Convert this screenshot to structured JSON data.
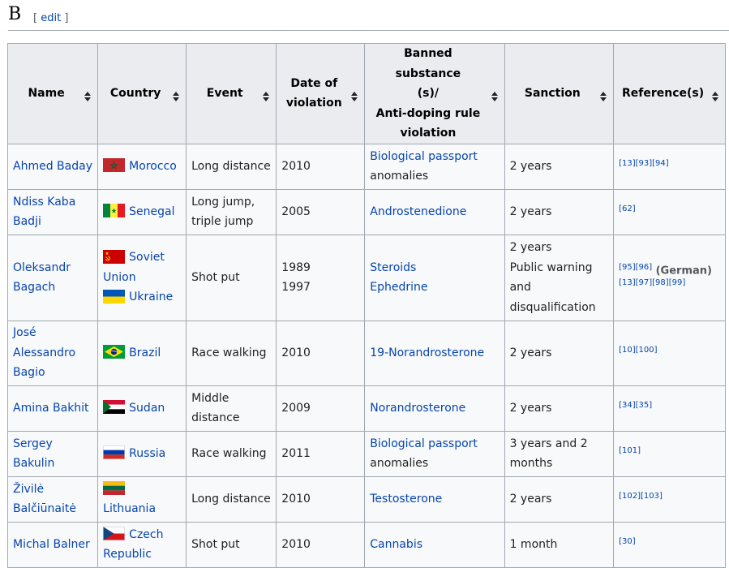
{
  "section": {
    "letter": "B",
    "edit_open": "[ ",
    "edit_label": "edit",
    "edit_close": " ]"
  },
  "table": {
    "columns": [
      {
        "l1": "Name",
        "l2": "",
        "l3": "",
        "l4": ""
      },
      {
        "l1": "Country",
        "l2": "",
        "l3": "",
        "l4": ""
      },
      {
        "l1": "Event",
        "l2": "",
        "l3": "",
        "l4": ""
      },
      {
        "l1": "Date of",
        "l2": "violation",
        "l3": "",
        "l4": ""
      },
      {
        "l1": "Banned substance",
        "l2": "(s)/",
        "l3": "Anti-doping rule",
        "l4": "violation"
      },
      {
        "l1": "Sanction",
        "l2": "",
        "l3": "",
        "l4": ""
      },
      {
        "l1": "Reference(s)",
        "l2": "",
        "l3": "",
        "l4": ""
      }
    ],
    "rows": [
      {
        "name": [
          "Ahmed Baday"
        ],
        "countries": [
          {
            "flag": "morocco-flag-icon",
            "lines": [
              "Morocco"
            ]
          }
        ],
        "event": [
          "Long distance"
        ],
        "date": [
          "2010"
        ],
        "substance": [
          {
            "text": "Biological passport",
            "link": true
          },
          {
            "text": "anomalies",
            "link": false
          }
        ],
        "sanction": [
          "2 years"
        ],
        "refs": [
          [
            "[13]",
            "[93]",
            "[94]"
          ]
        ],
        "note": ""
      },
      {
        "name": [
          "Ndiss Kaba",
          "Badji"
        ],
        "countries": [
          {
            "flag": "senegal-flag-icon",
            "lines": [
              "Senegal"
            ]
          }
        ],
        "event": [
          "Long jump,",
          "triple jump"
        ],
        "date": [
          "2005"
        ],
        "substance": [
          {
            "text": "Androstenedione",
            "link": true
          }
        ],
        "sanction": [
          "2 years"
        ],
        "refs": [
          [
            "[62]"
          ]
        ],
        "note": ""
      },
      {
        "name": [
          "Oleksandr",
          "Bagach"
        ],
        "countries": [
          {
            "flag": "soviet-union-flag-icon",
            "lines": [
              "Soviet",
              "Union"
            ]
          },
          {
            "flag": "ukraine-flag-icon",
            "lines": [
              "Ukraine"
            ]
          }
        ],
        "event": [
          "Shot put"
        ],
        "date": [
          "1989",
          "1997"
        ],
        "substance": [
          {
            "text": "Steroids",
            "link": true
          },
          {
            "text": "Ephedrine",
            "link": true
          }
        ],
        "sanction": [
          "2 years",
          "Public warning",
          "and",
          "disqualification"
        ],
        "refs": [
          [
            "[95]",
            "[96]"
          ],
          [
            "[13]",
            "[97]",
            "[98]",
            "[99]"
          ]
        ],
        "note": "(German)"
      },
      {
        "name": [
          "José",
          "Alessandro",
          "Bagio"
        ],
        "countries": [
          {
            "flag": "brazil-flag-icon",
            "lines": [
              "Brazil"
            ]
          }
        ],
        "event": [
          "Race walking"
        ],
        "date": [
          "2010"
        ],
        "substance": [
          {
            "text": "19-Norandrosterone",
            "link": true
          }
        ],
        "sanction": [
          "2 years"
        ],
        "refs": [
          [
            "[10]",
            "[100]"
          ]
        ],
        "note": ""
      },
      {
        "name": [
          "Amina Bakhit"
        ],
        "countries": [
          {
            "flag": "sudan-flag-icon",
            "lines": [
              "Sudan"
            ]
          }
        ],
        "event": [
          "Middle",
          "distance"
        ],
        "date": [
          "2009"
        ],
        "substance": [
          {
            "text": "Norandrosterone",
            "link": true
          }
        ],
        "sanction": [
          "2 years"
        ],
        "refs": [
          [
            "[34]",
            "[35]"
          ]
        ],
        "note": ""
      },
      {
        "name": [
          "Sergey",
          "Bakulin"
        ],
        "countries": [
          {
            "flag": "russia-flag-icon",
            "lines": [
              "Russia"
            ]
          }
        ],
        "event": [
          "Race walking"
        ],
        "date": [
          "2011"
        ],
        "substance": [
          {
            "text": "Biological passport",
            "link": true
          },
          {
            "text": "anomalies",
            "link": false
          }
        ],
        "sanction": [
          "3 years and 2",
          "months"
        ],
        "refs": [
          [
            "[101]"
          ]
        ],
        "note": ""
      },
      {
        "name": [
          "Živilė",
          "Balčiūnaitė"
        ],
        "countries": [
          {
            "flag": "lithuania-flag-icon",
            "lines": [
              "Lithuania"
            ]
          }
        ],
        "event": [
          "Long distance"
        ],
        "date": [
          "2010"
        ],
        "substance": [
          {
            "text": "Testosterone",
            "link": true
          }
        ],
        "sanction": [
          "2 years"
        ],
        "refs": [
          [
            "[102]",
            "[103]"
          ]
        ],
        "note": ""
      },
      {
        "name": [
          "Michal Balner"
        ],
        "countries": [
          {
            "flag": "czech-republic-flag-icon",
            "lines": [
              "Czech",
              "Republic"
            ]
          }
        ],
        "event": [
          "Shot put"
        ],
        "date": [
          "2010"
        ],
        "substance": [
          {
            "text": "Cannabis",
            "link": true
          }
        ],
        "sanction": [
          "1 month"
        ],
        "refs": [
          [
            "[30]"
          ]
        ],
        "note": ""
      }
    ]
  },
  "colors": {
    "link": "#0645ad",
    "header_bg": "#eaecf0",
    "cell_bg": "#f8f9fa",
    "border": "#a2a9b1"
  }
}
